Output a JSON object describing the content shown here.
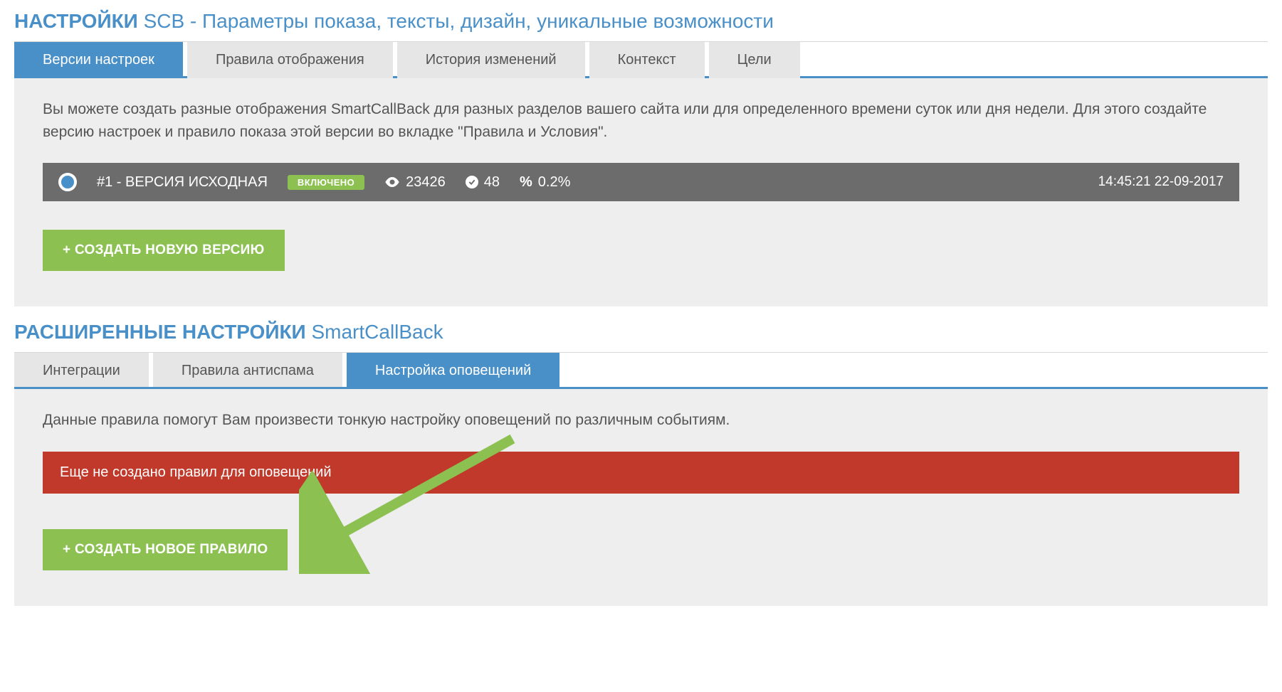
{
  "settings": {
    "title_strong": "НАСТРОЙКИ",
    "title_thin": "SCB - Параметры показа, тексты, дизайн, уникальные возможности",
    "tabs": [
      {
        "label": "Версии настроек",
        "active": true
      },
      {
        "label": "Правила отображения",
        "active": false
      },
      {
        "label": "История изменений",
        "active": false
      },
      {
        "label": "Контекст",
        "active": false
      },
      {
        "label": "Цели",
        "active": false
      }
    ],
    "intro": "Вы можете создать разные отображения SmartCallBack для разных разделов вашего сайта или для определенного времени суток или дня недели. Для этого создайте версию настроек и правило показа этой версии во вкладке \"Правила и Условия\".",
    "version_row": {
      "name": "#1 - ВЕРСИЯ ИСХОДНАЯ",
      "status_badge": "ВКЛЮЧЕНО",
      "views": "23426",
      "successes": "48",
      "percent": "0.2%",
      "timestamp": "14:45:21 22-09-2017"
    },
    "create_version_btn": "+ СОЗДАТЬ НОВУЮ ВЕРСИЮ"
  },
  "advanced": {
    "title_strong": "РАСШИРЕННЫЕ НАСТРОЙКИ",
    "title_thin": "SmartCallBack",
    "tabs": [
      {
        "label": "Интеграции",
        "active": false
      },
      {
        "label": "Правила антиспама",
        "active": false
      },
      {
        "label": "Настройка оповещений",
        "active": true
      }
    ],
    "intro": "Данные правила помогут Вам произвести тонкую настройку оповещений по различным событиям.",
    "alert": "Еще не создано правил для оповещений",
    "create_rule_btn": "+ СОЗДАТЬ НОВОЕ ПРАВИЛО"
  },
  "colors": {
    "accent_blue": "#4a90c8",
    "green": "#8cc152",
    "red": "#c0392b",
    "gray_bar": "#6c6c6c"
  }
}
